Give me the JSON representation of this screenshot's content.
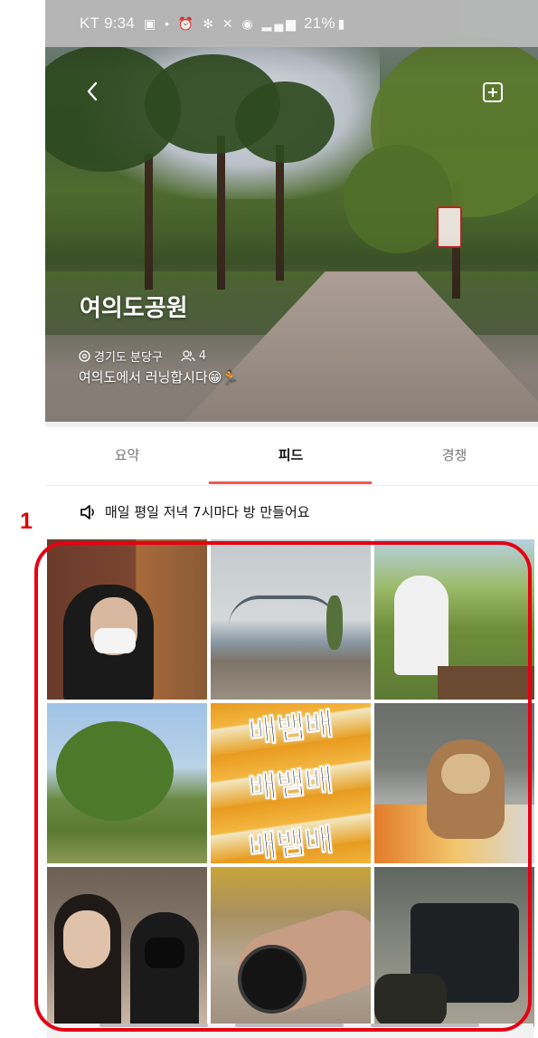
{
  "status_bar": {
    "carrier": "KT",
    "time": "9:34",
    "icons": [
      "image-icon",
      "alarm-icon",
      "bluetooth-icon",
      "mute-icon",
      "location-icon",
      "hd-icon",
      "5g-icon",
      "signal-icon"
    ],
    "battery": "21%"
  },
  "header": {
    "back_icon": "chevron-left-icon",
    "add_icon": "plus-square-icon",
    "title": "여의도공원",
    "location": "경기도 분당구",
    "member_count": "4",
    "description": "여의도에서 러닝합시다😁🏃"
  },
  "tabs": [
    {
      "label": "요약",
      "active": false
    },
    {
      "label": "피드",
      "active": true
    },
    {
      "label": "경쟁",
      "active": false
    }
  ],
  "notice": {
    "icon": "speaker-icon",
    "text": "매일 평일 저녁 7시마다 방 만들어요"
  },
  "annotation": {
    "number": "1",
    "color": "#e60012"
  },
  "feed": {
    "photos": [
      {
        "subject": "person-masked-indoor"
      },
      {
        "subject": "river-bridge"
      },
      {
        "subject": "person-park-bench"
      },
      {
        "subject": "tree-sky"
      },
      {
        "subject": "snack-packages"
      },
      {
        "subject": "puppy"
      },
      {
        "subject": "friends-selfie"
      },
      {
        "subject": "smartwatch"
      },
      {
        "subject": "bag"
      }
    ],
    "snack_label": "배뱀배"
  },
  "colors": {
    "accent": "#f2574d",
    "annotation": "#e60012"
  }
}
